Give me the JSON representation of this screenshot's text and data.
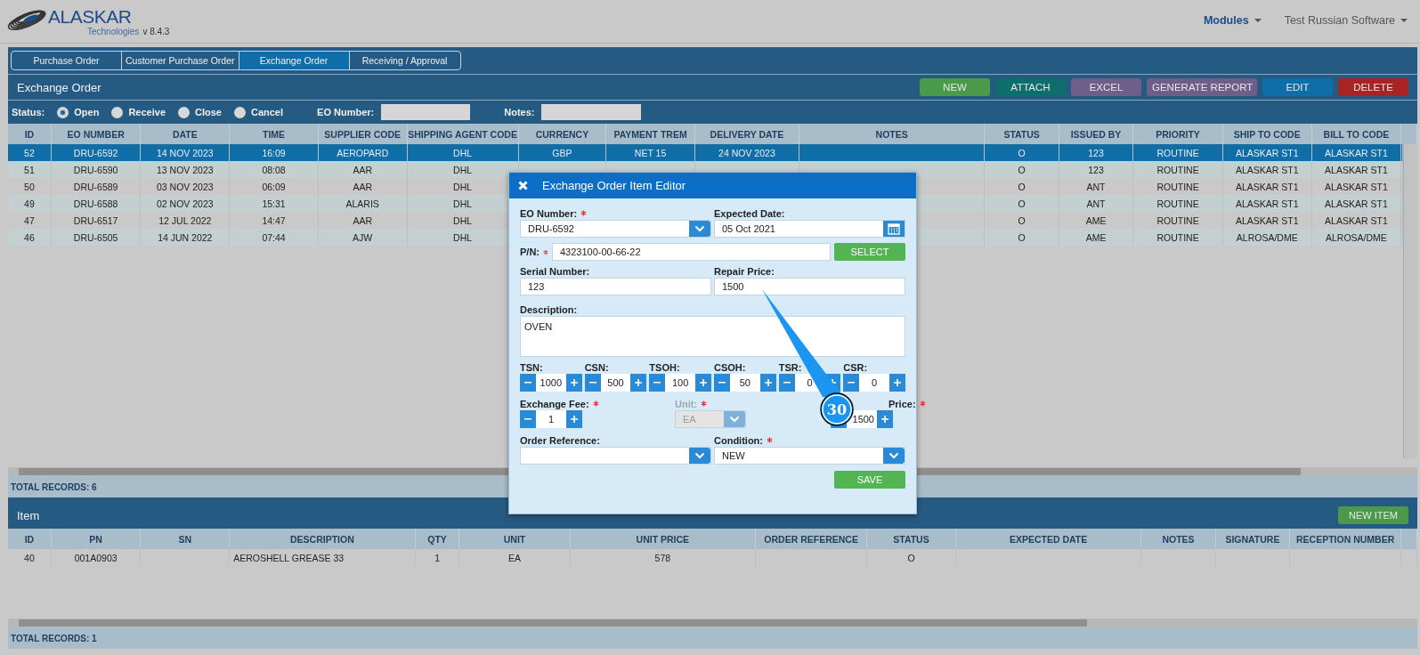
{
  "header": {
    "brand": "ALASKAR",
    "tagline": "Technologies",
    "version": "v 8.4.3",
    "menus": [
      {
        "label": "Modules",
        "kind": "strong"
      },
      {
        "label": "Test Russian Software",
        "kind": "plain"
      }
    ]
  },
  "tabs": [
    {
      "label": "Purchase Order",
      "selected": false
    },
    {
      "label": "Customer Purchase Order",
      "selected": false
    },
    {
      "label": "Exchange Order",
      "selected": true
    },
    {
      "label": "Receiving / Approval",
      "selected": false
    }
  ],
  "panel_title": "Exchange Order",
  "actions": [
    {
      "label": "NEW",
      "color": "#4a9a4a"
    },
    {
      "label": "ATTACH",
      "color": "#0f6e6c"
    },
    {
      "label": "EXCEL",
      "color": "#6d5e8a"
    },
    {
      "label": "GENERATE REPORT",
      "color": "#6d5e8a"
    },
    {
      "label": "EDIT",
      "color": "#0f6ea8"
    },
    {
      "label": "DELETE",
      "color": "#a82424"
    }
  ],
  "filters": {
    "status_label": "Status:",
    "statuses": [
      {
        "label": "Open",
        "selected": true
      },
      {
        "label": "Receive",
        "selected": false
      },
      {
        "label": "Close",
        "selected": false
      },
      {
        "label": "Cancel",
        "selected": false
      }
    ],
    "eo_number_label": "EO Number:",
    "notes_label": "Notes:"
  },
  "table": {
    "columns": [
      "ID",
      "EO NUMBER",
      "DATE",
      "TIME",
      "SUPPLIER CODE",
      "SHIPPING AGENT CODE",
      "CURRENCY",
      "PAYMENT TREM",
      "DELIVERY DATE",
      "NOTES",
      "STATUS",
      "ISSUED BY",
      "PRIORITY",
      "SHIP TO CODE",
      "BILL TO CODE"
    ],
    "rows": [
      {
        "selected": true,
        "cells": [
          "52",
          "DRU-6592",
          "14 NOV 2023",
          "16:09",
          "AEROPARD",
          "DHL",
          "GBP",
          "NET 15",
          "24 NOV 2023",
          null,
          "O",
          "123",
          "ROUTINE",
          "ALASKAR ST1",
          "ALASKAR ST1"
        ]
      },
      {
        "selected": false,
        "cells": [
          "51",
          "DRU-6590",
          "13 NOV 2023",
          "08:08",
          "AAR",
          "DHL",
          null,
          null,
          null,
          null,
          "O",
          "123",
          "ROUTINE",
          "ALASKAR ST1",
          "ALASKAR ST1"
        ]
      },
      {
        "selected": false,
        "cells": [
          "50",
          "DRU-6589",
          "03 NOV 2023",
          "06:09",
          "AAR",
          "DHL",
          null,
          null,
          null,
          null,
          "O",
          "ANT",
          "ROUTINE",
          "ALASKAR ST1",
          "ALASKAR ST1"
        ]
      },
      {
        "selected": false,
        "cells": [
          "49",
          "DRU-6588",
          "02 NOV 2023",
          "15:31",
          "ALARIS",
          "DHL",
          null,
          null,
          null,
          null,
          "O",
          "ANT",
          "ROUTINE",
          "ALASKAR ST1",
          "ALASKAR ST1"
        ]
      },
      {
        "selected": false,
        "cells": [
          "47",
          "DRU-6517",
          "12 JUL 2022",
          "14:47",
          "AAR",
          "DHL",
          null,
          null,
          null,
          null,
          "O",
          "AME",
          "ROUTINE",
          "ALASKAR ST1",
          "ALASKAR ST1"
        ]
      },
      {
        "selected": false,
        "cells": [
          "46",
          "DRU-6505",
          "14 JUN 2022",
          "07:44",
          "AJW",
          "DHL",
          null,
          null,
          null,
          null,
          "O",
          "AME",
          "ROUTINE",
          "ALROSA/DME",
          "ALROSA/DME"
        ]
      }
    ],
    "total": "TOTAL RECORDS: 6"
  },
  "item_panel": {
    "title": "Item",
    "new_button": "NEW ITEM",
    "columns": [
      "ID",
      "PN",
      "SN",
      "DESCRIPTION",
      "QTY",
      "UNIT",
      "UNIT PRICE",
      "ORDER REFERENCE",
      "STATUS",
      "EXPECTED DATE",
      "NOTES",
      "SIGNATURE",
      "RECEPTION NUMBER"
    ],
    "rows": [
      {
        "selected": false,
        "cells": [
          "40",
          "001A0903",
          null,
          "AEROSHELL GREASE 33",
          "1",
          "EA",
          "578",
          null,
          "O",
          null,
          null,
          null,
          null
        ]
      }
    ],
    "total": "TOTAL RECORDS: 1"
  },
  "editor": {
    "title": "Exchange Order Item Editor",
    "eo_number": {
      "label": "EO Number:",
      "required": true,
      "value": "DRU-6592"
    },
    "expected_date": {
      "label": "Expected Date:",
      "required": false,
      "value": "05 Oct 2021"
    },
    "pn": {
      "label": "P/N:",
      "required": true,
      "value": "4323100-00-66-22"
    },
    "select_button": "SELECT",
    "serial_number": {
      "label": "Serial Number:",
      "value": "123"
    },
    "repair_price": {
      "label": "Repair Price:",
      "value": "1500"
    },
    "description": {
      "label": "Description:",
      "value": "OVEN"
    },
    "counters": [
      {
        "label": "TSN:",
        "value": "1000"
      },
      {
        "label": "CSN:",
        "value": "500"
      },
      {
        "label": "TSOH:",
        "value": "100"
      },
      {
        "label": "CSOH:",
        "value": "50"
      },
      {
        "label": "TSR:",
        "value": "0"
      },
      {
        "label": "CSR:",
        "value": "0"
      }
    ],
    "exchange_fee": {
      "label": "Exchange Fee:",
      "required": true,
      "value": "1"
    },
    "unit": {
      "label": "Unit:",
      "required": true,
      "value": "EA",
      "disabled": true
    },
    "price": {
      "label": "Price:",
      "required": true,
      "value": "1500"
    },
    "order_reference": {
      "label": "Order Reference:",
      "required": false
    },
    "condition": {
      "label": "Condition:",
      "required": true,
      "value": "NEW"
    },
    "save_button": "SAVE"
  },
  "callout": {
    "label": "30"
  }
}
